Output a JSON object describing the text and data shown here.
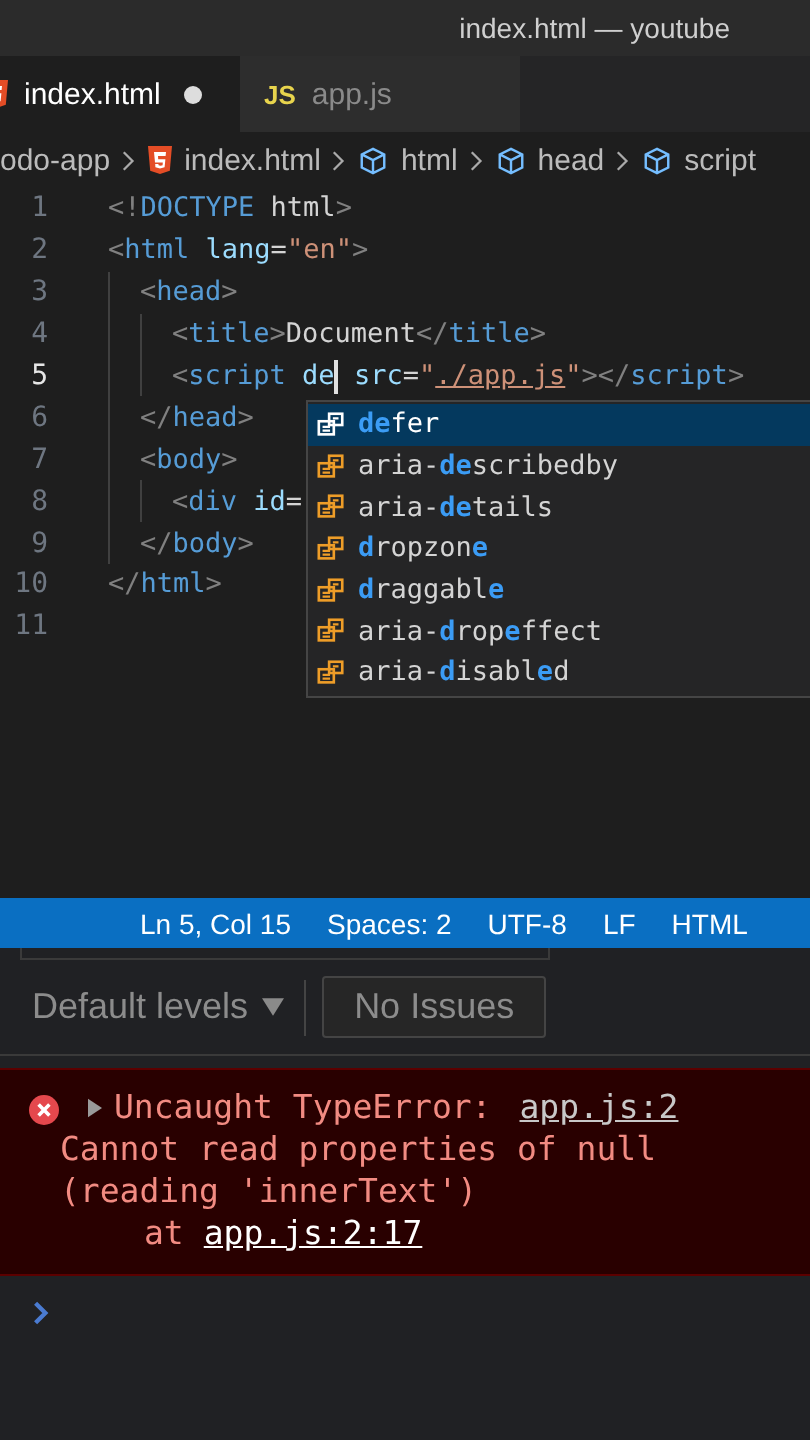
{
  "window": {
    "title": "index.html — youtube"
  },
  "tabs": [
    {
      "kind": "html",
      "label": "index.html",
      "selected": true,
      "dirty": true
    },
    {
      "kind": "js",
      "icon_text": "JS",
      "label": "app.js",
      "selected": false,
      "dirty": false
    }
  ],
  "breadcrumb": [
    {
      "kind": "folder",
      "label": "odo-app"
    },
    {
      "kind": "html",
      "label": "index.html"
    },
    {
      "kind": "element",
      "label": "html"
    },
    {
      "kind": "element",
      "label": "head"
    },
    {
      "kind": "element",
      "label": "script"
    }
  ],
  "editor": {
    "lines": [
      {
        "num": "1",
        "current": false,
        "tokens": [
          {
            "kind": "punct",
            "text": "<!"
          },
          {
            "kind": "tag",
            "text": "DOCTYPE"
          },
          {
            "kind": "text",
            "text": " html"
          },
          {
            "kind": "punct",
            "text": ">"
          }
        ]
      },
      {
        "num": "2",
        "current": false,
        "tokens": [
          {
            "kind": "punct",
            "text": "<"
          },
          {
            "kind": "tag",
            "text": "html"
          },
          {
            "kind": "attr",
            "text": " lang"
          },
          {
            "kind": "text",
            "text": "="
          },
          {
            "kind": "str",
            "text": "\"en\""
          },
          {
            "kind": "punct",
            "text": ">"
          }
        ],
        "children": [
          {
            "num": "3",
            "current": false,
            "tokens": [
              {
                "kind": "punct",
                "text": "<"
              },
              {
                "kind": "tag",
                "text": "head"
              },
              {
                "kind": "punct",
                "text": ">"
              }
            ],
            "children": [
              {
                "num": "4",
                "current": false,
                "tokens": [
                  {
                    "kind": "punct",
                    "text": "<"
                  },
                  {
                    "kind": "tag",
                    "text": "title"
                  },
                  {
                    "kind": "punct",
                    "text": ">"
                  },
                  {
                    "kind": "text",
                    "text": "Document"
                  },
                  {
                    "kind": "punct",
                    "text": "</"
                  },
                  {
                    "kind": "tag",
                    "text": "title"
                  },
                  {
                    "kind": "punct",
                    "text": ">"
                  }
                ]
              },
              {
                "num": "5",
                "current": true,
                "tokens": [
                  {
                    "kind": "punct",
                    "text": "<"
                  },
                  {
                    "kind": "tag",
                    "text": "script"
                  },
                  {
                    "kind": "attr",
                    "text": " de"
                  },
                  {
                    "kind": "cursor"
                  },
                  {
                    "kind": "attr",
                    "text": " src"
                  },
                  {
                    "kind": "text",
                    "text": "="
                  },
                  {
                    "kind": "str",
                    "text": "\""
                  },
                  {
                    "kind": "link",
                    "text": "./app.js"
                  },
                  {
                    "kind": "str",
                    "text": "\""
                  },
                  {
                    "kind": "punct",
                    "text": "></"
                  },
                  {
                    "kind": "tag",
                    "text": "script"
                  },
                  {
                    "kind": "punct",
                    "text": ">"
                  }
                ]
              }
            ]
          },
          {
            "num": "6",
            "current": false,
            "tokens": [
              {
                "kind": "punct",
                "text": "</"
              },
              {
                "kind": "tag",
                "text": "head"
              },
              {
                "kind": "punct",
                "text": ">"
              }
            ]
          },
          {
            "num": "7",
            "current": false,
            "tokens": [
              {
                "kind": "punct",
                "text": "<"
              },
              {
                "kind": "tag",
                "text": "body"
              },
              {
                "kind": "punct",
                "text": ">"
              }
            ],
            "children": [
              {
                "num": "8",
                "current": false,
                "tokens": [
                  {
                    "kind": "punct",
                    "text": "<"
                  },
                  {
                    "kind": "tag",
                    "text": "div"
                  },
                  {
                    "kind": "attr",
                    "text": " id"
                  },
                  {
                    "kind": "text",
                    "text": "="
                  }
                ]
              }
            ]
          },
          {
            "num": "9",
            "current": false,
            "tokens": [
              {
                "kind": "punct",
                "text": "</"
              },
              {
                "kind": "tag",
                "text": "body"
              },
              {
                "kind": "punct",
                "text": ">"
              }
            ]
          }
        ]
      },
      {
        "num": "10",
        "current": false,
        "tokens": [
          {
            "kind": "punct",
            "text": "</"
          },
          {
            "kind": "tag",
            "text": "html"
          },
          {
            "kind": "punct",
            "text": ">"
          }
        ]
      },
      {
        "num": "11",
        "current": false
      }
    ]
  },
  "suggestions": [
    {
      "selected": true,
      "parts": [
        {
          "text": "de",
          "match": true
        },
        {
          "text": "fer",
          "match": false
        }
      ]
    },
    {
      "selected": false,
      "parts": [
        {
          "text": "aria-",
          "match": false
        },
        {
          "text": "de",
          "match": true
        },
        {
          "text": "scribedby",
          "match": false
        }
      ]
    },
    {
      "selected": false,
      "parts": [
        {
          "text": "aria-",
          "match": false
        },
        {
          "text": "de",
          "match": true
        },
        {
          "text": "tails",
          "match": false
        }
      ]
    },
    {
      "selected": false,
      "parts": [
        {
          "text": "d",
          "match": true
        },
        {
          "text": "ropzon",
          "match": false
        },
        {
          "text": "e",
          "match": true
        }
      ]
    },
    {
      "selected": false,
      "parts": [
        {
          "text": "d",
          "match": true
        },
        {
          "text": "raggabl",
          "match": false
        },
        {
          "text": "e",
          "match": true
        }
      ]
    },
    {
      "selected": false,
      "parts": [
        {
          "text": "aria-",
          "match": false
        },
        {
          "text": "d",
          "match": true
        },
        {
          "text": "rop",
          "match": false
        },
        {
          "text": "e",
          "match": true
        },
        {
          "text": "ffect",
          "match": false
        }
      ]
    },
    {
      "selected": false,
      "parts": [
        {
          "text": "aria-",
          "match": false
        },
        {
          "text": "d",
          "match": true
        },
        {
          "text": "isabl",
          "match": false
        },
        {
          "text": "e",
          "match": true
        },
        {
          "text": "d",
          "match": false
        }
      ]
    }
  ],
  "status_bar": [
    "Ln 5, Col 15",
    "Spaces: 2",
    "UTF-8",
    "LF",
    "HTML"
  ],
  "console": {
    "levels": "Default levels",
    "issues": "No Issues",
    "error": {
      "title": "Uncaught TypeError:",
      "source": "app.js:2",
      "message": [
        "Cannot read properties of null",
        "(reading 'innerText')"
      ],
      "at": "at",
      "location": "app.js:2:17"
    }
  }
}
